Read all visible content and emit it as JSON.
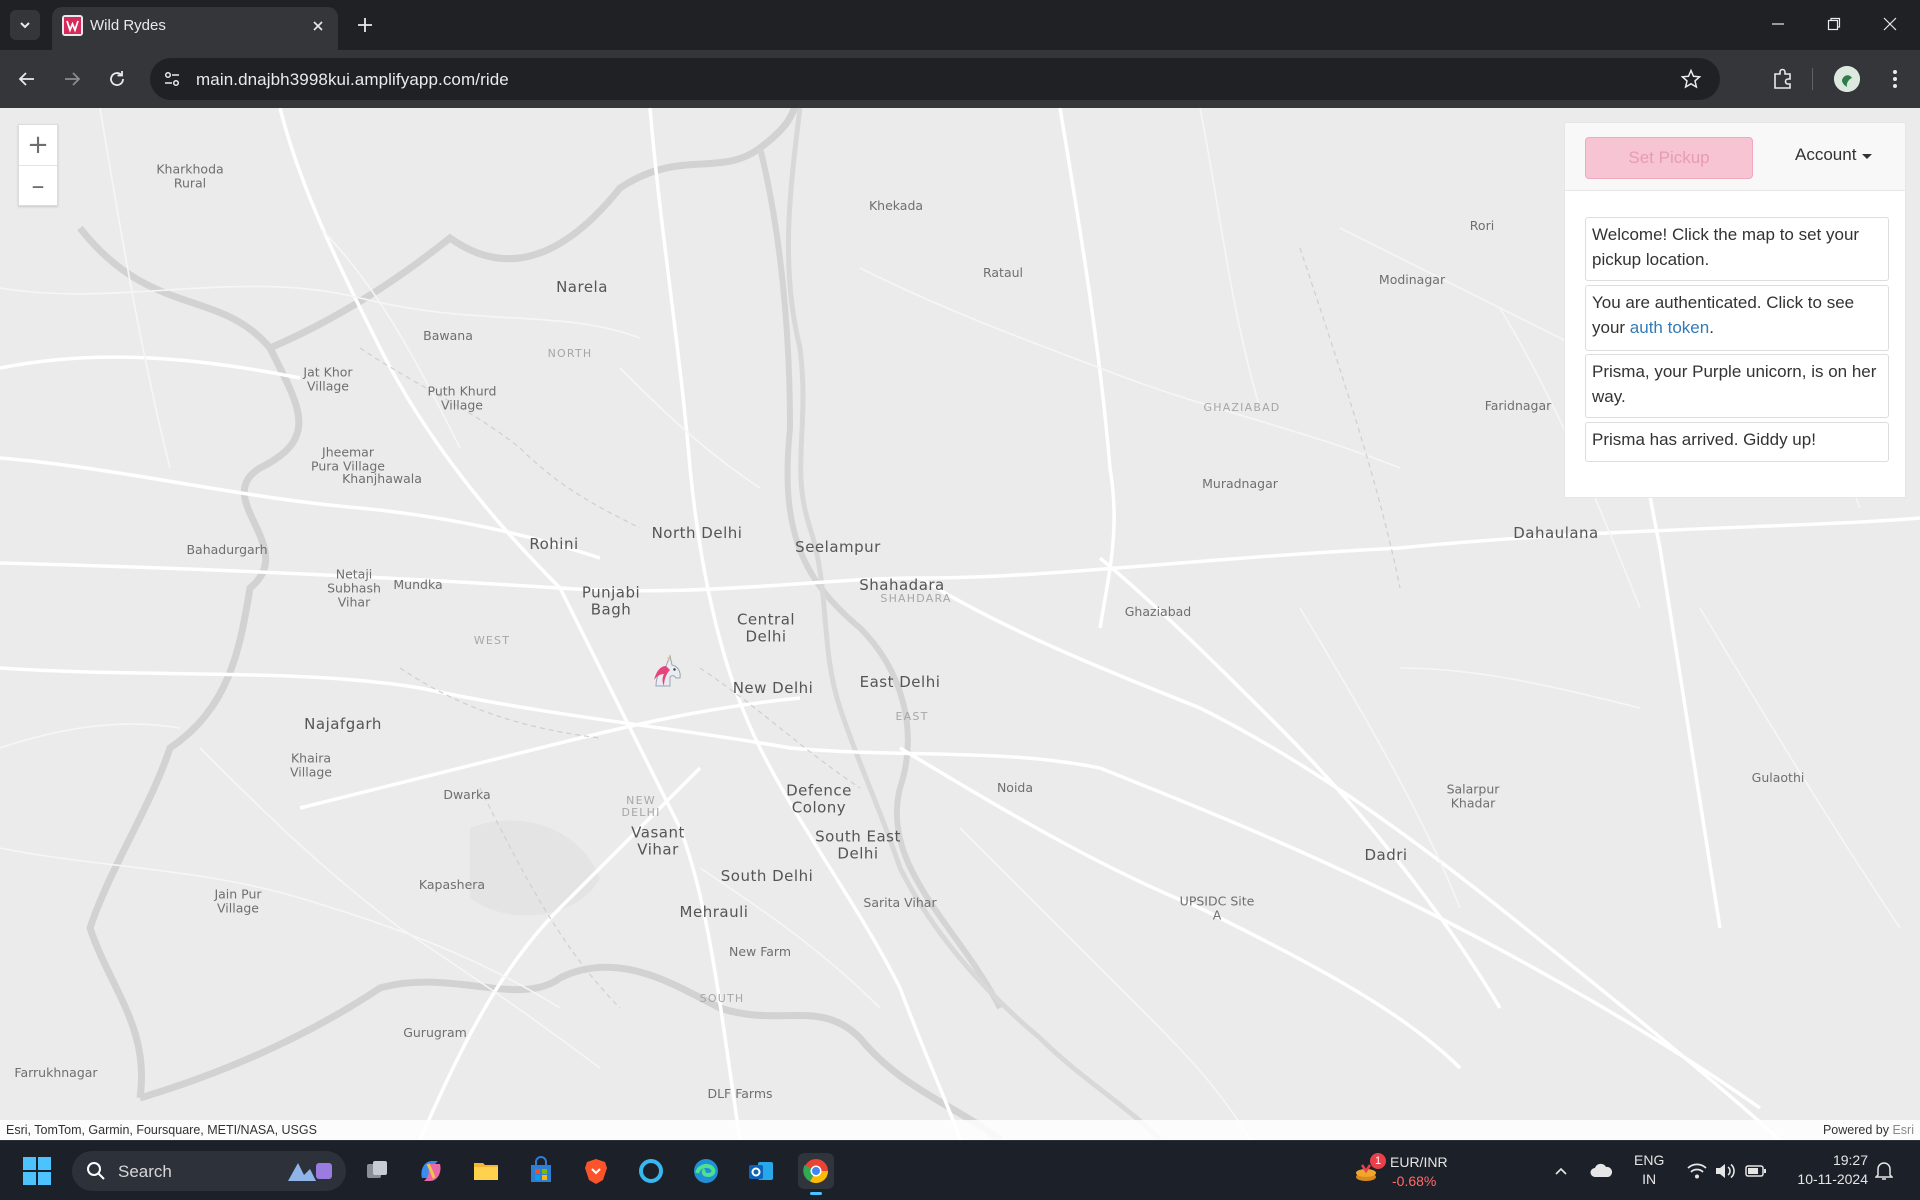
{
  "browser": {
    "tab_title": "Wild Rydes",
    "url": "main.dnajbh3998kui.amplifyapp.com/ride"
  },
  "map": {
    "labels": {
      "kharkhoda": "Kharkhoda\nRural",
      "khekada": "Khekada",
      "rataul": "Rataul",
      "rori": "Rori",
      "modinagar": "Modinagar",
      "narela": "Narela",
      "north": "NORTH",
      "bawana": "Bawana",
      "jat_khor": "Jat Khor\nVillage",
      "puth_khurd": "Puth Khurd\nVillage",
      "ghaziabad_district": "GHAZIABAD",
      "faridnagar": "Faridnagar",
      "jheemar": "Jheemar\nPura Village",
      "khanjhawala": "Khanjhawala",
      "muradnagar": "Muradnagar",
      "rohini": "Rohini",
      "north_delhi": "North Delhi",
      "seelampur": "Seelampur",
      "dahaulana": "Dahaulana",
      "bahadurgarh": "Bahadurgarh",
      "netaji": "Netaji\nSubhash\nVihar",
      "mundka": "Mundka",
      "punjabi_bagh": "Punjabi\nBagh",
      "shahadara": "Shahadara",
      "shahdara_district": "SHAHDARA",
      "central_delhi": "Central\nDelhi",
      "ghaziabad": "Ghaziabad",
      "west": "WEST",
      "new_delhi": "New Delhi",
      "east_delhi": "East Delhi",
      "east": "EAST",
      "najafgarh": "Najafgarh",
      "khaira": "Khaira\nVillage",
      "dwarka": "Dwarka",
      "new_delhi_district": "NEW\nDELHI",
      "defence_colony": "Defence\nColony",
      "noida": "Noida",
      "salarpur": "Salarpur\nKhadar",
      "gulaothi": "Gulaothi",
      "vasant_vihar": "Vasant\nVihar",
      "south_east_delhi": "South East\nDelhi",
      "dadri": "Dadri",
      "kapashera": "Kapashera",
      "south_delhi": "South Delhi",
      "jain_pur": "Jain Pur\nVillage",
      "mehrauli": "Mehrauli",
      "sarita_vihar": "Sarita Vihar",
      "upsidc": "UPSIDC Site\nA",
      "new_farm": "New Farm",
      "south": "SOUTH",
      "gurugram": "Gurugram",
      "farrukhnagar": "Farrukhnagar",
      "dlf_farms": "DLF Farms"
    },
    "attribution_left": "Esri, TomTom, Garmin, Foursquare, METI/NASA, USGS",
    "attribution_powered": "Powered by",
    "attribution_esri": "Esri"
  },
  "panel": {
    "set_pickup_label": "Set Pickup",
    "account_label": "Account",
    "messages": {
      "welcome": "Welcome! Click the map to set your pickup location.",
      "auth_prefix": "You are authenticated. Click to see your ",
      "auth_link": "auth token",
      "auth_suffix": ".",
      "on_way": "Prisma, your Purple unicorn, is on her way.",
      "arrived": "Prisma has arrived. Giddy up!"
    }
  },
  "taskbar": {
    "search_placeholder": "Search",
    "widget_badge": "1",
    "widget_name": "EUR/INR",
    "widget_value": "-0.68%",
    "lang_line1": "ENG",
    "lang_line2": "IN",
    "time": "19:27",
    "date": "10-11-2024"
  },
  "colors": {
    "pickup_button": "#f7c4d3",
    "link": "#337ab7",
    "widget_negative": "#ff6b6b"
  }
}
